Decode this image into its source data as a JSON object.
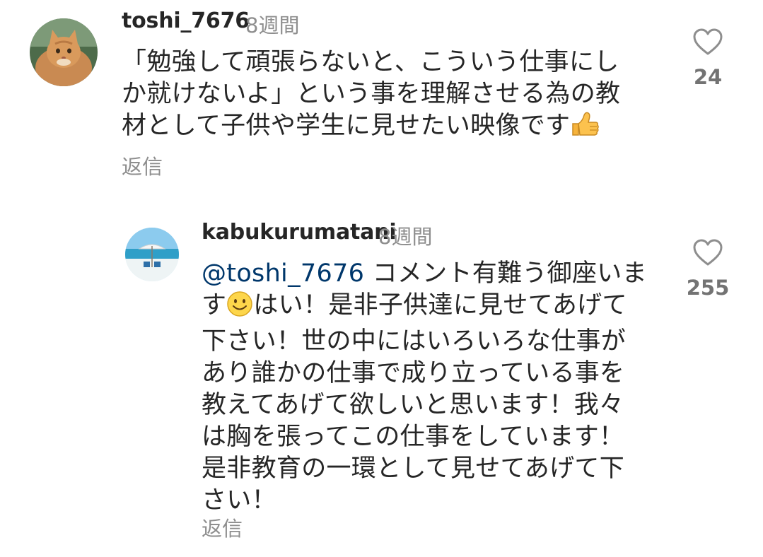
{
  "comments": [
    {
      "username": "toshi_7676",
      "time": "8週間",
      "text_lines": [
        "「勉強して頑張らないと、こういう仕事にし",
        "か就けないよ」という事を理解させる為の教",
        "材として子供や学生に見せたい映像です"
      ],
      "emoji": "thumbs-up-icon",
      "reply_label": "返信",
      "like_count": "24",
      "avatar": "cat-avatar"
    },
    {
      "username": "kabukurumatani",
      "time": "8週間",
      "mention": "@toshi_7676",
      "text_first": " コメント有難う御座いま",
      "text_second_a": "す",
      "emoji": "smiley-icon",
      "text_second_b": "はい！是非子供達に見せてあげて",
      "text_lines": [
        "下さい！世の中にはいろいろな仕事が",
        "あり誰かの仕事で成り立っている事を",
        "教えてあげて欲しいと思います！我々",
        "は胸を張ってこの仕事をしています！",
        "是非教育の一環として見せてあげて下",
        "さい！"
      ],
      "reply_label": "返信",
      "like_count": "255",
      "avatar": "beach-avatar"
    }
  ],
  "colors": {
    "text": "#262626",
    "secondary": "#8e8e8e",
    "mention": "#00376b",
    "like_count": "#737373"
  }
}
